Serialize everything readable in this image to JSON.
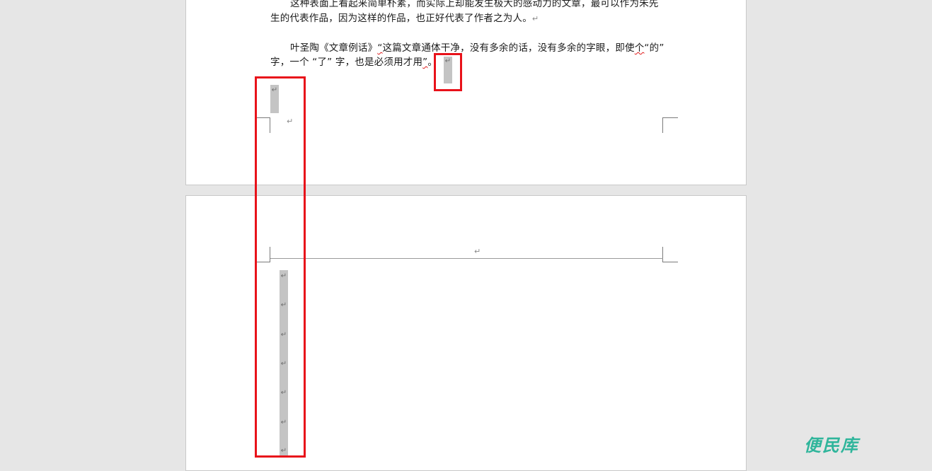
{
  "document": {
    "paragraph1": {
      "line1": "这种表面上看起来简单朴素，而实际上却能发生极大的感动力的文章，最可以作为朱先",
      "line2": "生的代表作品，因为这样的作品，也正好代表了作者之为人。"
    },
    "paragraph2": {
      "line1_a": "叶圣陶《文章例话》",
      "line1_b": "“",
      "line1_c": "这篇文章通体干净，没有多余的话，没有多余的字眼，即使",
      "line1_d": "个",
      "line1_e": "“的”",
      "line2_a": "字，一个 “了” 字，也是必须用才用",
      "line2_b": "”",
      "line2_c": "。"
    },
    "paragraph_mark": "↵"
  },
  "watermark": {
    "text": "便民库",
    "color": "#2fb59b"
  },
  "colors": {
    "workspace_bg": "#e6e6e6",
    "page_bg": "#ffffff",
    "highlight_box": "#e8121a",
    "selection": "#c4c4c4"
  }
}
